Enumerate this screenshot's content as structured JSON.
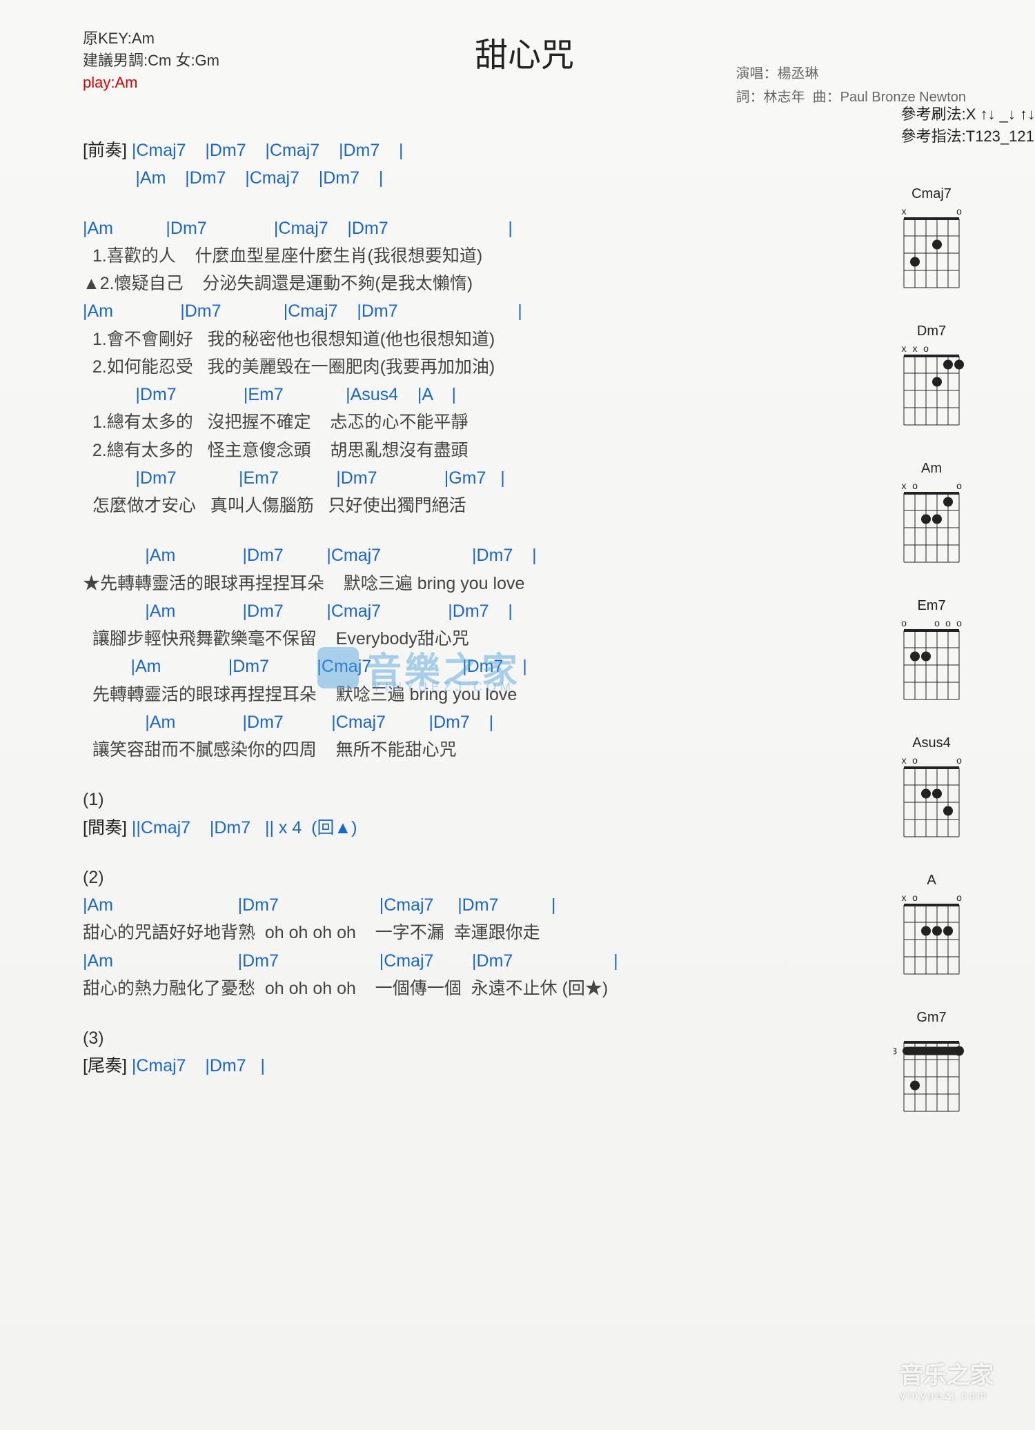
{
  "meta": {
    "title": "甜心咒",
    "original_key": "原KEY:Am",
    "suggested": "建議男調:Cm 女:Gm",
    "play": "play:Am",
    "singer_label": "演唱：",
    "singer": "楊丞琳",
    "lyricist_label": "詞：",
    "lyricist": "林志年",
    "composer_label": "曲：",
    "composer": "Paul Bronze Newton",
    "strum_label": "參考刷法:",
    "strum": "X ↑↓ _↓ ↑↓",
    "finger_label": "參考指法:",
    "finger": "T123_121"
  },
  "labels": {
    "intro": "[前奏]",
    "interlude": "[間奏]",
    "outro": "[尾奏]"
  },
  "watermark": {
    "main": "音樂之家",
    "sub": "YINYUEZJ.COM"
  },
  "footer": {
    "main": "音乐之家",
    "sub": "yinyuezj.com"
  },
  "diagrams": [
    "Cmaj7",
    "Dm7",
    "Am",
    "Em7",
    "Asus4",
    "A",
    "Gm7"
  ],
  "intro": {
    "line1": " |Cmaj7    |Dm7    |Cmaj7    |Dm7    |",
    "line2": "           |Am    |Dm7    |Cmaj7    |Dm7    |"
  },
  "verse1": {
    "chords": "|Am           |Dm7              |Cmaj7    |Dm7                         |",
    "lyric1": "  1.喜歡的人    什麼血型星座什麼生肖(我很想要知道)",
    "lyric2": "▲2.懷疑自己    分泌失調還是運動不夠(是我太懶惰)"
  },
  "verse2": {
    "chords": "|Am              |Dm7             |Cmaj7    |Dm7                         |",
    "lyric1": "  1.會不會剛好   我的秘密他也很想知道(他也很想知道)",
    "lyric2": "  2.如何能忍受   我的美麗毀在一圈肥肉(我要再加加油)"
  },
  "pre1": {
    "chords": "           |Dm7              |Em7             |Asus4    |A    |",
    "lyric1": "  1.總有太多的   沒把握不確定    忐忑的心不能平靜",
    "lyric2": "  2.總有太多的   怪主意傻念頭    胡思亂想沒有盡頭"
  },
  "pre2": {
    "chords": "           |Dm7             |Em7            |Dm7              |Gm7   |",
    "lyric": "  怎麼做才安心   真叫人傷腦筋   只好使出獨門絕活"
  },
  "chorus": {
    "l1c": "             |Am              |Dm7         |Cmaj7                   |Dm7    |",
    "l1": "★先轉轉靈活的眼球再捏捏耳朵    默唸三遍 bring you love",
    "l2c": "             |Am              |Dm7         |Cmaj7              |Dm7    |",
    "l2": "  讓腳步輕快飛舞歡樂毫不保留    Everybody甜心咒",
    "l3c": "          |Am              |Dm7          |Cmaj7                   |Dm7    |",
    "l3": "  先轉轉靈活的眼球再捏捏耳朵    默唸三遍 bring you love",
    "l4c": "             |Am              |Dm7          |Cmaj7         |Dm7    |",
    "l4": "  讓笑容甜而不膩感染你的四周    無所不能甜心咒"
  },
  "mark1": "(1)",
  "interlude": {
    "line": " ||Cmaj7    |Dm7   || x 4  (回▲)"
  },
  "mark2": "(2)",
  "bridge": {
    "c1": "|Am                          |Dm7                     |Cmaj7     |Dm7           |",
    "l1": "甜心的咒語好好地背熟  oh oh oh oh    一字不漏  幸運跟你走",
    "c2": "|Am                          |Dm7                     |Cmaj7        |Dm7                     |",
    "l2": "甜心的熱力融化了憂愁  oh oh oh oh    一個傳一個  永遠不止休 (回★)"
  },
  "mark3": "(3)",
  "outro": {
    "line": " |Cmaj7    |Dm7   |"
  }
}
